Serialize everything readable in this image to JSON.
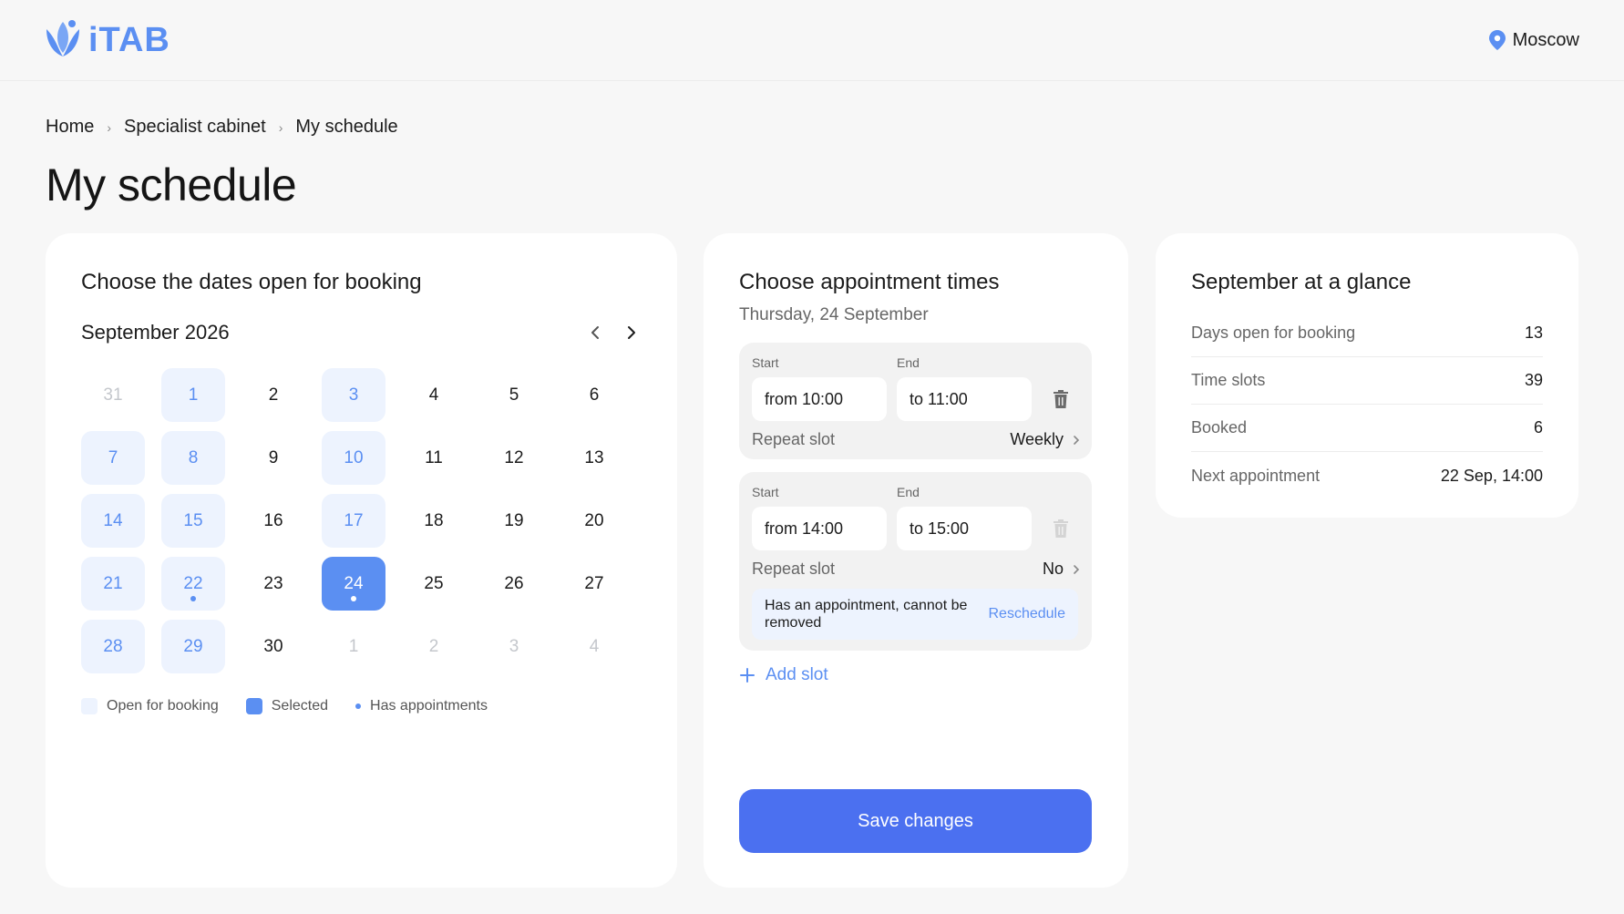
{
  "header": {
    "logo_text": "iTAB",
    "city": "Moscow"
  },
  "breadcrumb": [
    "Home",
    "Specialist cabinet",
    "My schedule"
  ],
  "page_title": "My schedule",
  "calendar": {
    "title": "Choose the dates open for booking",
    "month_label": "September 2026",
    "days": [
      {
        "label": "31",
        "state": "muted"
      },
      {
        "label": "1",
        "state": "open"
      },
      {
        "label": "2",
        "state": "normal"
      },
      {
        "label": "3",
        "state": "open"
      },
      {
        "label": "4",
        "state": "normal"
      },
      {
        "label": "5",
        "state": "normal"
      },
      {
        "label": "6",
        "state": "normal"
      },
      {
        "label": "7",
        "state": "open"
      },
      {
        "label": "8",
        "state": "open"
      },
      {
        "label": "9",
        "state": "normal"
      },
      {
        "label": "10",
        "state": "open"
      },
      {
        "label": "11",
        "state": "normal"
      },
      {
        "label": "12",
        "state": "normal"
      },
      {
        "label": "13",
        "state": "normal"
      },
      {
        "label": "14",
        "state": "open"
      },
      {
        "label": "15",
        "state": "open"
      },
      {
        "label": "16",
        "state": "normal"
      },
      {
        "label": "17",
        "state": "open"
      },
      {
        "label": "18",
        "state": "normal"
      },
      {
        "label": "19",
        "state": "normal"
      },
      {
        "label": "20",
        "state": "normal"
      },
      {
        "label": "21",
        "state": "open"
      },
      {
        "label": "22",
        "state": "open",
        "dot": true
      },
      {
        "label": "23",
        "state": "normal"
      },
      {
        "label": "24",
        "state": "selected",
        "dot": true
      },
      {
        "label": "25",
        "state": "normal"
      },
      {
        "label": "26",
        "state": "normal"
      },
      {
        "label": "27",
        "state": "normal"
      },
      {
        "label": "28",
        "state": "open"
      },
      {
        "label": "29",
        "state": "open"
      },
      {
        "label": "30",
        "state": "normal"
      },
      {
        "label": "1",
        "state": "muted"
      },
      {
        "label": "2",
        "state": "muted"
      },
      {
        "label": "3",
        "state": "muted"
      },
      {
        "label": "4",
        "state": "muted"
      }
    ],
    "legend": {
      "open": "Open for booking",
      "selected": "Selected",
      "appointments": "Has appointments"
    }
  },
  "times": {
    "title": "Choose appointment times",
    "subtitle": "Thursday, 24 September",
    "start_label": "Start",
    "end_label": "End",
    "repeat_label": "Repeat slot",
    "slots": [
      {
        "start": "from 10:00",
        "end": "to 11:00",
        "repeat": "Weekly"
      },
      {
        "start": "from 14:00",
        "end": "to 15:00",
        "repeat": "No",
        "notice": "Has an appointment, cannot be removed",
        "action": "Reschedule"
      }
    ],
    "add_slot": "Add slot",
    "save": "Save changes"
  },
  "glance": {
    "title": "September at a glance",
    "rows": [
      {
        "label": "Days open for booking",
        "value": "13"
      },
      {
        "label": "Time slots",
        "value": "39"
      },
      {
        "label": "Booked",
        "value": "6"
      },
      {
        "label": "Next appointment",
        "value": "22 Sep, 14:00"
      }
    ]
  },
  "colors": {
    "accent": "#5b8ff2",
    "open_bg": "#edf3fe",
    "button": "#4b70f0"
  }
}
